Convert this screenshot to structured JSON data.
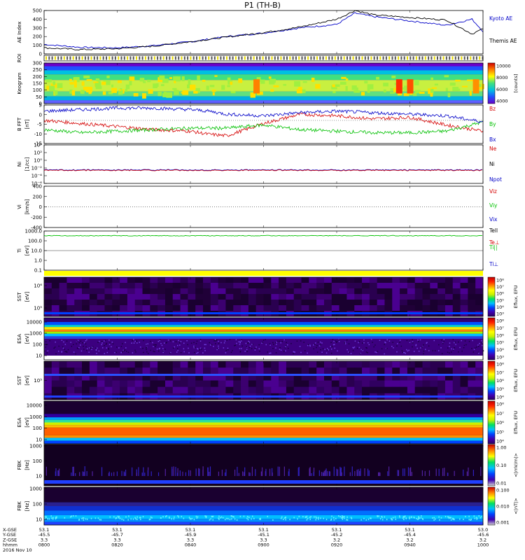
{
  "title": "P1 (TH-B)",
  "footer": {
    "row_labels": [
      "X-GSE",
      "Y-GSE",
      "Z-GSE",
      "hhmm",
      "2016 Nov 10"
    ],
    "columns": [
      {
        "x": "53.1",
        "y": "-45.5",
        "z": "3.3",
        "t": "0800"
      },
      {
        "x": "53.1",
        "y": "-45.7",
        "z": "3.3",
        "t": "0820"
      },
      {
        "x": "53.1",
        "y": "-45.9",
        "z": "3.3",
        "t": "0840"
      },
      {
        "x": "53.1",
        "y": "-45.1",
        "z": "3.3",
        "t": "0900"
      },
      {
        "x": "53.1",
        "y": "-45.2",
        "z": "3.2",
        "t": "0920"
      },
      {
        "x": "53.1",
        "y": "-45.4",
        "z": "3.2",
        "t": "0940"
      },
      {
        "x": "53.0",
        "y": "-45.6",
        "z": "3.2",
        "t": "1000"
      }
    ]
  },
  "colors": {
    "red": "#d40000",
    "green": "#00c000",
    "blue": "#0000c8",
    "black": "#000000"
  },
  "chart_data": [
    {
      "id": "ae",
      "type": "line",
      "ylabel": "AE Index",
      "ylim": [
        0,
        500
      ],
      "yticks": [
        "500",
        "400",
        "300",
        "200",
        "100",
        "0"
      ],
      "x": [
        "08:00",
        "08:10",
        "08:20",
        "08:30",
        "08:40",
        "08:50",
        "09:00",
        "09:10",
        "09:20",
        "09:25",
        "09:30",
        "09:40",
        "09:50",
        "09:57",
        "10:00"
      ],
      "series": [
        {
          "name": "Kyoto AE",
          "color": "#0000c8",
          "values": [
            110,
            75,
            70,
            95,
            140,
            200,
            240,
            300,
            340,
            470,
            430,
            380,
            330,
            400,
            260
          ]
        },
        {
          "name": "Themis AE",
          "color": "#000000",
          "values": [
            70,
            50,
            60,
            90,
            140,
            195,
            245,
            310,
            400,
            500,
            450,
            420,
            390,
            230,
            290
          ]
        }
      ]
    },
    {
      "id": "roi",
      "type": "table",
      "ylabel": "ROI",
      "ylim": [
        0,
        1
      ]
    },
    {
      "id": "keogram",
      "type": "heatmap",
      "ylabel": "Keogram",
      "ylim": [
        0,
        300
      ],
      "yticks": [
        "300",
        "250",
        "200",
        "150",
        "100",
        "50",
        "0"
      ],
      "colorbar": {
        "label": "[counts]",
        "ticks": [
          "10000",
          "8000",
          "6000",
          "4000"
        ]
      }
    },
    {
      "id": "bfield",
      "type": "line",
      "ylabel": "B FFT",
      "unit": "[nT]",
      "ylim": [
        -15,
        10
      ],
      "yticks": [
        "5",
        "0",
        "-5",
        "-10",
        "-15"
      ],
      "x": [
        "08:00",
        "08:10",
        "08:20",
        "08:30",
        "08:40",
        "08:45",
        "08:50",
        "09:00",
        "09:10",
        "09:20",
        "09:30",
        "09:40",
        "09:50",
        "10:00"
      ],
      "series": [
        {
          "name": "Bz",
          "color": "#d40000",
          "values": [
            0,
            -2,
            -4,
            -6,
            -7,
            -9,
            -10,
            -2,
            4,
            3,
            1,
            2,
            -3,
            -7
          ]
        },
        {
          "name": "By",
          "color": "#00c000",
          "values": [
            -6,
            -8,
            -7,
            -6,
            -5,
            -5,
            -5,
            -3,
            -6,
            -7,
            -8,
            -8,
            -7,
            -1
          ]
        },
        {
          "name": "Bx",
          "color": "#0000c8",
          "values": [
            6,
            7,
            8,
            8,
            7,
            6,
            4,
            3,
            5,
            6,
            5,
            4,
            3,
            -1
          ]
        }
      ]
    },
    {
      "id": "density",
      "type": "line",
      "ylabel": "Ni",
      "unit": "[1/cc]",
      "ylim": [
        -6,
        4
      ],
      "yticks": [
        "10⁴",
        "10²",
        "10⁰",
        "10⁻²",
        "10⁻⁴",
        "10⁻⁶"
      ],
      "legend": [
        "Ne",
        "Ni",
        "Npot"
      ]
    },
    {
      "id": "velocity",
      "type": "line",
      "ylabel": "Vi",
      "unit": "[km/s]",
      "ylim": [
        -400,
        400
      ],
      "yticks": [
        "400",
        "200",
        "0",
        "-200",
        "-400"
      ],
      "legend": [
        "Viz",
        "Viy",
        "Vix"
      ]
    },
    {
      "id": "temp",
      "type": "line",
      "ylabel": "Ti",
      "unit": "[eV]",
      "ylim": [
        0.1,
        1000
      ],
      "yticks": [
        "1000.0",
        "100.0",
        "10.0",
        "1.0",
        "0.1"
      ],
      "legend": [
        "Tell",
        "Te⊥",
        "Ti||",
        "Ti⊥"
      ]
    },
    {
      "id": "sst1",
      "type": "heatmap",
      "ylabel": "SST",
      "unit": "[eV]",
      "yticks": [
        "10⁶",
        "10⁵"
      ],
      "colorbar": {
        "label": "Eflux, EFU",
        "ticks": [
          "10⁸",
          "10⁷",
          "10⁶",
          "10⁵",
          "10⁴",
          "10³"
        ]
      }
    },
    {
      "id": "esa1",
      "type": "heatmap",
      "ylabel": "ESA",
      "unit": "[eV]",
      "yticks": [
        "10000",
        "1000",
        "100",
        "10"
      ],
      "colorbar": {
        "label": "Eflux, EFU",
        "ticks": [
          "10⁸",
          "10⁷",
          "10⁶",
          "10⁵",
          "10⁴",
          "10³"
        ]
      }
    },
    {
      "id": "sst2",
      "type": "heatmap",
      "ylabel": "SST",
      "unit": "[eV]",
      "yticks": [
        "10⁵"
      ],
      "colorbar": {
        "label": "Eflux, EFU",
        "ticks": [
          "10⁸",
          "10⁷",
          "10⁶",
          "10⁵",
          "10⁴"
        ]
      }
    },
    {
      "id": "esa2",
      "type": "heatmap",
      "ylabel": "ESA",
      "unit": "[eV]",
      "yticks": [
        "10000",
        "1000",
        "100",
        "10"
      ],
      "colorbar": {
        "label": "Eflux, EFU",
        "ticks": [
          "10⁸",
          "10⁷",
          "10⁶",
          "10⁵",
          "10⁴"
        ]
      }
    },
    {
      "id": "fbk1",
      "type": "heatmap",
      "ylabel": "FBK",
      "unit": "[Hz]",
      "yticks": [
        "1000",
        "100",
        "10"
      ],
      "colorbar": {
        "label": "<|mV/m|>",
        "ticks": [
          "1.00",
          "0.10",
          "0.01"
        ]
      }
    },
    {
      "id": "fbk2",
      "type": "heatmap",
      "ylabel": "FBK",
      "unit": "[Hz]",
      "yticks": [
        "1000",
        "100",
        "10"
      ],
      "colorbar": {
        "label": "<|nT|>",
        "ticks": [
          "0.100",
          "0.010",
          "0.001"
        ]
      }
    }
  ]
}
